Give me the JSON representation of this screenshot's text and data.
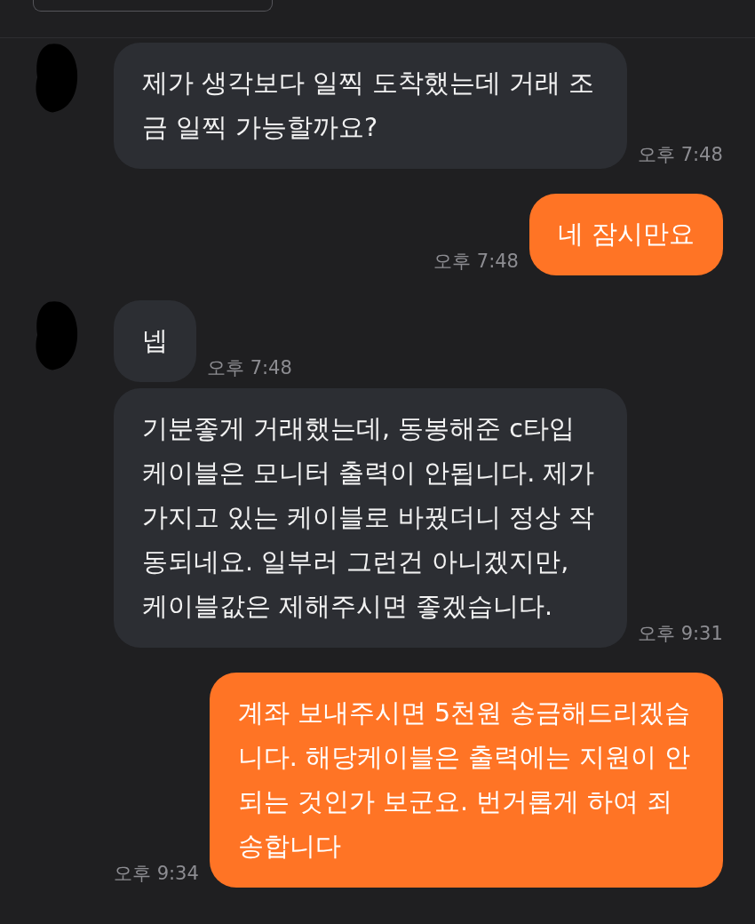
{
  "messages": [
    {
      "kind": "incoming",
      "show_avatar": true,
      "text": "제가 생각보다 일찍 도착했는데 거래 조금 일찍 가능할까요?",
      "time": "오후 7:48"
    },
    {
      "kind": "outgoing",
      "text": "네 잠시만요",
      "time": "오후 7:48"
    },
    {
      "kind": "incoming",
      "show_avatar": true,
      "text": "넵",
      "time": "오후 7:48"
    },
    {
      "kind": "incoming",
      "show_avatar": false,
      "text": "기분좋게 거래했는데, 동봉해준 c타입 케이블은 모니터 출력이 안됩니다. 제가 가지고 있는 케이블로 바꿨더니 정상 작동되네요. 일부러 그런건 아니겠지만, 케이블값은 제해주시면 좋겠습니다.",
      "time": "오후 9:31"
    },
    {
      "kind": "outgoing",
      "text": "계좌 보내주시면 5천원 송금해드리겠습니다. 해당케이블은 출력에는 지원이 안되는 것인가 보군요. 번거롭게 하여 죄송합니다",
      "time": "오후 9:34"
    }
  ]
}
